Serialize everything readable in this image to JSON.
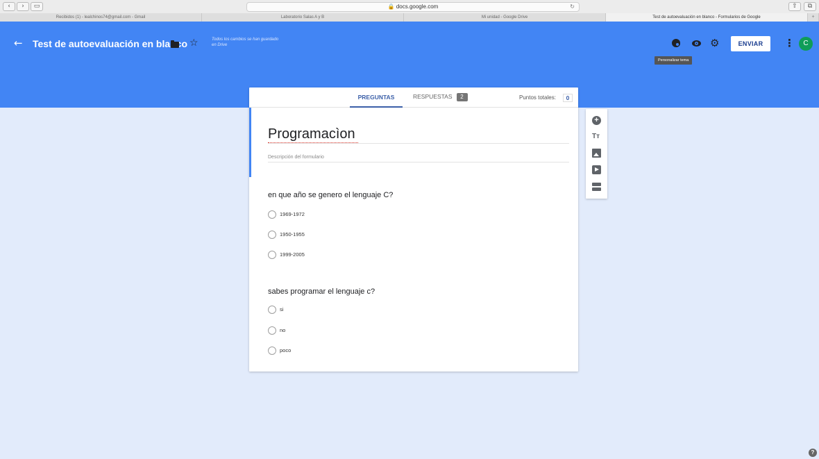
{
  "browser": {
    "url": "🔒 docs.google.com",
    "tabs": [
      "Recibidos (1) - lealchinos74@gmail.com - Gmail",
      "Laboratorio Salas A y B",
      "Mi unidad - Google Drive",
      "Test de autoevaluación en blanco - Formularios de Google"
    ]
  },
  "header": {
    "doc_title": "Test de autoevaluación en blanco",
    "saved_note": "Todos los cambios se han guardado en Drive",
    "send_label": "ENVIAR",
    "avatar_letter": "C",
    "tooltip": "Personalizar tema",
    "colors": {
      "header": "#4285f4",
      "avatar": "#0f9d58"
    }
  },
  "card": {
    "tabs": {
      "questions": "PREGUNTAS",
      "responses": "RESPUESTAS",
      "responses_count": "2"
    },
    "points_label": "Puntos totales:",
    "points_value": "0",
    "form_title": "Programacìon",
    "form_description": "Descripción del formulario",
    "questions": [
      {
        "title": "en que año se genero el lenguaje C?",
        "options": [
          "1969-1972",
          "1950-1955",
          "1999-2005"
        ]
      },
      {
        "title": "sabes programar el lenguaje c?",
        "options": [
          "si",
          "no",
          "poco"
        ]
      }
    ]
  },
  "toolbar": {
    "icons": [
      "add-question-icon",
      "title-text-icon",
      "image-icon",
      "video-icon",
      "section-icon"
    ],
    "text_glyph": "Tт"
  }
}
